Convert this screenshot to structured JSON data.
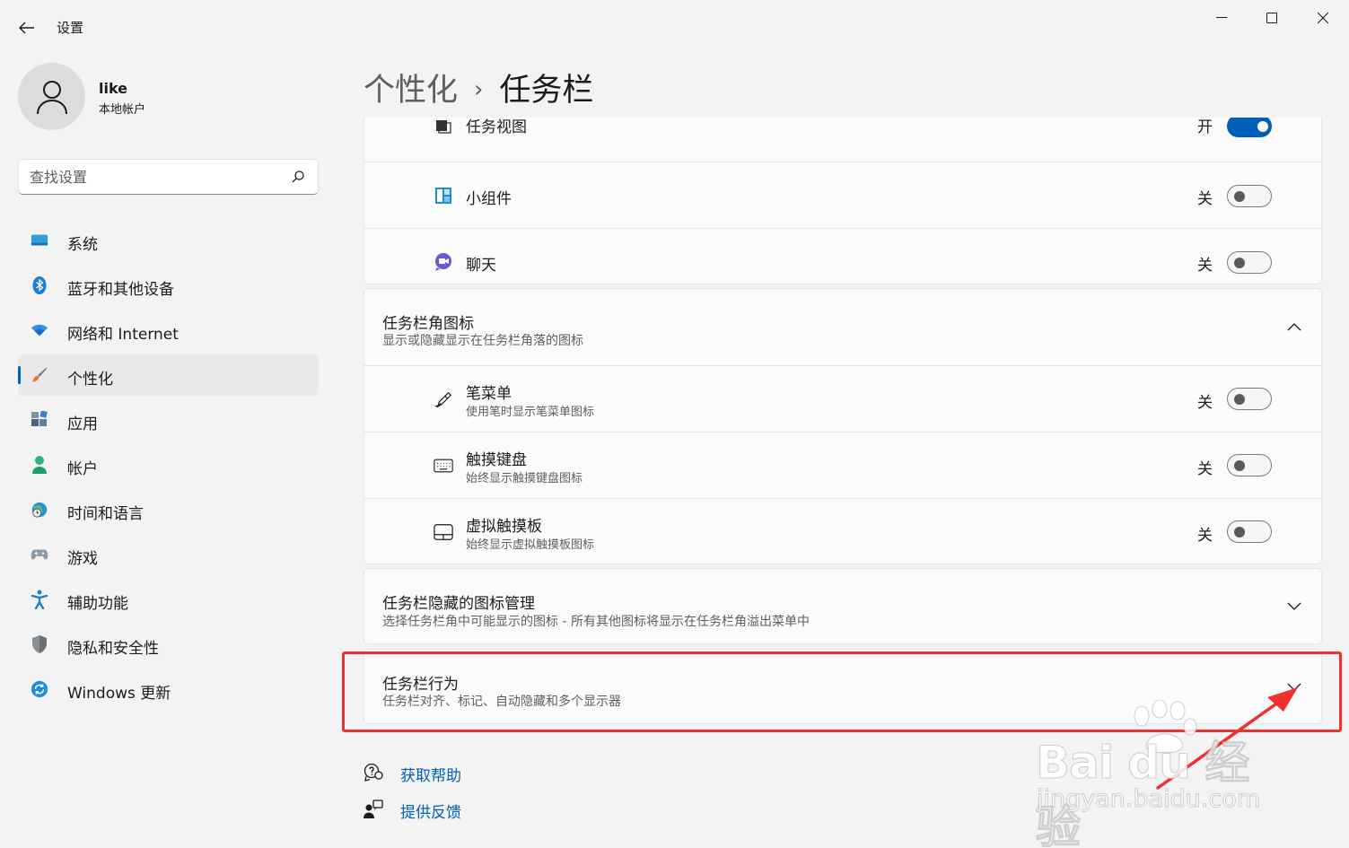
{
  "window": {
    "title": "设置"
  },
  "profile": {
    "name": "like",
    "account_type": "本地帐户"
  },
  "search": {
    "placeholder": "查找设置"
  },
  "sidebar": {
    "items": [
      {
        "label": "系统",
        "icon": "system-icon"
      },
      {
        "label": "蓝牙和其他设备",
        "icon": "bluetooth-icon"
      },
      {
        "label": "网络和 Internet",
        "icon": "wifi-icon"
      },
      {
        "label": "个性化",
        "icon": "brush-icon",
        "active": true
      },
      {
        "label": "应用",
        "icon": "apps-icon"
      },
      {
        "label": "帐户",
        "icon": "account-icon"
      },
      {
        "label": "时间和语言",
        "icon": "globe-clock-icon"
      },
      {
        "label": "游戏",
        "icon": "gamepad-icon"
      },
      {
        "label": "辅助功能",
        "icon": "accessibility-icon"
      },
      {
        "label": "隐私和安全性",
        "icon": "shield-icon"
      },
      {
        "label": "Windows 更新",
        "icon": "update-icon"
      }
    ]
  },
  "breadcrumb": {
    "parent": "个性化",
    "separator": "›",
    "current": "任务栏"
  },
  "taskbar_items": {
    "rows": [
      {
        "title": "任务视图",
        "state": "开",
        "on": true,
        "icon": "task-view-icon"
      },
      {
        "title": "小组件",
        "state": "关",
        "on": false,
        "icon": "widgets-icon"
      },
      {
        "title": "聊天",
        "state": "关",
        "on": false,
        "icon": "chat-icon"
      }
    ]
  },
  "corner_icons": {
    "title": "任务栏角图标",
    "description": "显示或隐藏显示在任务栏角落的图标",
    "expanded": true,
    "rows": [
      {
        "title": "笔菜单",
        "description": "使用笔时显示笔菜单图标",
        "state": "关",
        "on": false,
        "icon": "pen-icon"
      },
      {
        "title": "触摸键盘",
        "description": "始终显示触摸键盘图标",
        "state": "关",
        "on": false,
        "icon": "keyboard-icon"
      },
      {
        "title": "虚拟触摸板",
        "description": "始终显示虚拟触摸板图标",
        "state": "关",
        "on": false,
        "icon": "touchpad-icon"
      }
    ]
  },
  "overflow": {
    "title": "任务栏隐藏的图标管理",
    "description": "选择任务栏角中可能显示的图标 - 所有其他图标将显示在任务栏角溢出菜单中",
    "expanded": false
  },
  "behaviors": {
    "title": "任务栏行为",
    "description": "任务栏对齐、标记、自动隐藏和多个显示器",
    "expanded": false
  },
  "help_links": {
    "get_help": "获取帮助",
    "feedback": "提供反馈"
  },
  "watermark": {
    "main": "Bai du 经验",
    "sub": "jingyan.baidu.com"
  },
  "colors": {
    "accent": "#005fb8",
    "annotation_red": "#f0302e"
  }
}
